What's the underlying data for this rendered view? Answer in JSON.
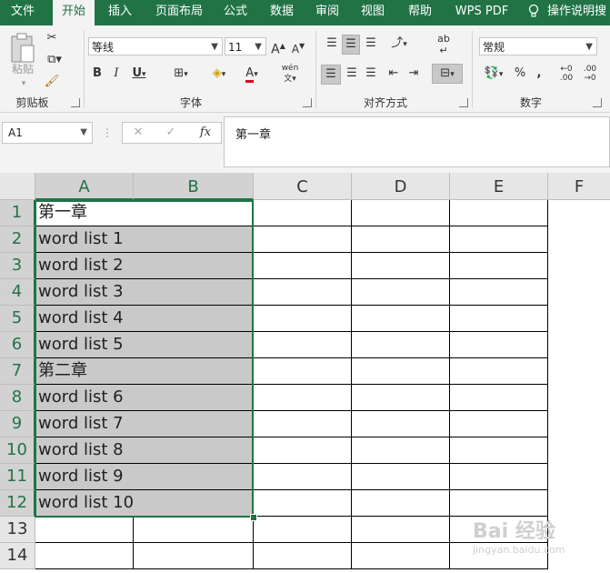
{
  "menu": {
    "tabs": [
      "文件",
      "开始",
      "插入",
      "页面布局",
      "公式",
      "数据",
      "审阅",
      "视图",
      "帮助",
      "WPS PDF",
      "操作说明搜"
    ],
    "active": "开始"
  },
  "ribbon": {
    "clipboard": {
      "paste_label": "粘贴",
      "group_label": "剪贴板"
    },
    "font": {
      "font_name": "等线",
      "font_size": "11",
      "group_label": "字体"
    },
    "alignment": {
      "group_label": "对齐方式"
    },
    "number": {
      "format": "常规",
      "group_label": "数字",
      "percent": "%",
      "comma": ",",
      "wen": "wén"
    }
  },
  "formula_bar": {
    "name_box": "A1",
    "content": "第一章"
  },
  "columns": [
    "A",
    "B",
    "C",
    "D",
    "E",
    "F"
  ],
  "rows": [
    "1",
    "2",
    "3",
    "4",
    "5",
    "6",
    "7",
    "8",
    "9",
    "10",
    "11",
    "12",
    "13",
    "14"
  ],
  "cells": [
    "第一章",
    "word list 1",
    "word list 2",
    "word list 3",
    "word list 4",
    "word list 5",
    "第二章",
    "word list 6",
    "word list 7",
    "word list 8",
    "word list 9",
    "word list 10"
  ],
  "watermark": {
    "main": "Bai 经验",
    "sub": "jingyan.baidu.com"
  },
  "colors": {
    "accent": "#217346",
    "selection": "#c9c9c9"
  }
}
